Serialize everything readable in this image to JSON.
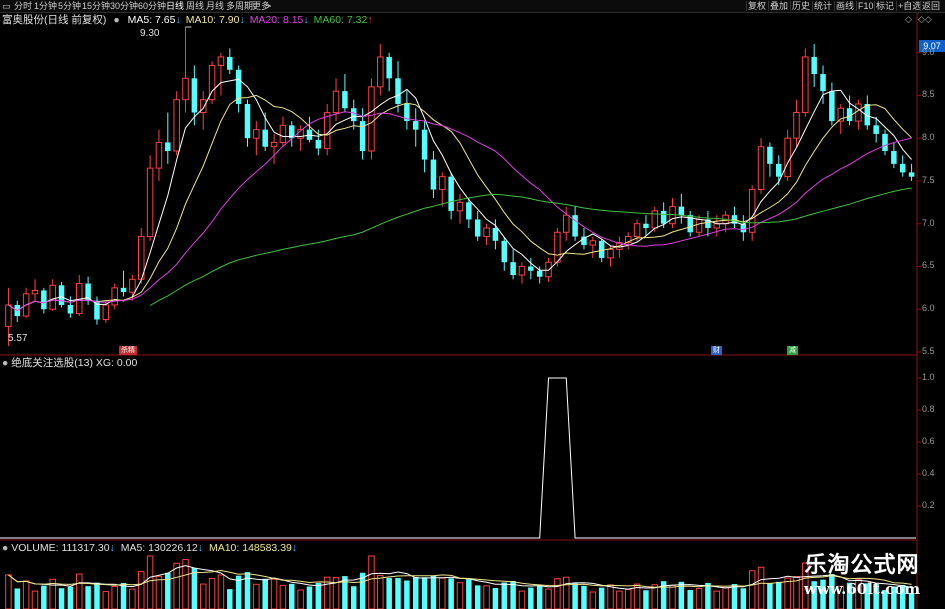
{
  "toolbar": {
    "left_icon": "window-icon",
    "items": [
      "分时",
      "1分钟",
      "5分钟",
      "15分钟",
      "30分钟",
      "60分钟",
      "日线",
      "周线",
      "月线",
      "多周期",
      "更多"
    ],
    "more_arrow": ">",
    "active_index": 6,
    "right_items": [
      "复权",
      "叠加",
      "历史",
      "统计",
      "画线",
      "F10",
      "标记",
      "+自选",
      "返回"
    ]
  },
  "main_panel": {
    "title": "富奥股份(日线 前复权)",
    "ma_items": [
      {
        "label": "MA5:",
        "value": "7.65",
        "arrow": "↓",
        "color": "#ffffff"
      },
      {
        "label": "MA10:",
        "value": "7.90",
        "arrow": "↓",
        "color": "#f0e68c"
      },
      {
        "label": "MA20:",
        "value": "8.15",
        "arrow": "↓",
        "color": "#e040e0"
      },
      {
        "label": "MA60:",
        "value": "7.32",
        "arrow": "↑",
        "color": "#40c040"
      }
    ],
    "high_label": "9.30",
    "low_label": "5.57",
    "current_price_tag": "9.07",
    "y_ticks": [
      "9.0",
      "8.5",
      "8.0",
      "7.5",
      "7.0",
      "6.5",
      "6.0",
      "5.5"
    ],
    "event_tags": [
      {
        "text": "杀精",
        "color": "#c03030"
      },
      {
        "text": "财",
        "color": "#3060c0"
      },
      {
        "text": "减",
        "color": "#30a040"
      }
    ],
    "icons": [
      "diamond-icon",
      "arrows-icon"
    ]
  },
  "indicator_panel": {
    "title": "绝底关注选股(13) XG: 0.00",
    "y_ticks": [
      "1.0",
      "0.8",
      "0.6",
      "0.4",
      "0.2"
    ]
  },
  "volume_panel": {
    "label": "VOLUME:",
    "value": "111317.30",
    "arrow": "↓",
    "ma5_label": "MA5:",
    "ma5_value": "130226.12",
    "ma5_arrow": "↓",
    "ma10_label": "MA10:",
    "ma10_value": "148583.39",
    "ma10_arrow": "↓"
  },
  "watermark": {
    "title": "乐淘公式网",
    "url": "www.60lt.com"
  },
  "colors": {
    "up": "#ff4040",
    "down": "#54ffff",
    "ma5": "#ffffff",
    "ma10": "#f0e68c",
    "ma20": "#e040e0",
    "ma60": "#40c040"
  },
  "chart_data": {
    "type": "candlestick",
    "ylim": [
      5.5,
      9.3
    ],
    "candles": [
      [
        5.8,
        6.25,
        5.57,
        6.05
      ],
      [
        6.05,
        6.1,
        5.85,
        5.92
      ],
      [
        5.92,
        6.25,
        5.9,
        6.18
      ],
      [
        6.18,
        6.35,
        6.1,
        6.22
      ],
      [
        6.22,
        6.25,
        5.95,
        6.0
      ],
      [
        6.0,
        6.35,
        5.98,
        6.28
      ],
      [
        6.28,
        6.32,
        6.02,
        6.05
      ],
      [
        6.05,
        6.15,
        5.9,
        5.95
      ],
      [
        5.95,
        6.4,
        5.92,
        6.3
      ],
      [
        6.3,
        6.38,
        6.05,
        6.1
      ],
      [
        6.1,
        6.15,
        5.82,
        5.88
      ],
      [
        5.88,
        6.1,
        5.84,
        6.05
      ],
      [
        6.05,
        6.3,
        6.0,
        6.25
      ],
      [
        6.25,
        6.45,
        6.15,
        6.2
      ],
      [
        6.2,
        6.4,
        6.1,
        6.35
      ],
      [
        6.35,
        6.95,
        6.3,
        6.85
      ],
      [
        6.85,
        7.8,
        6.8,
        7.65
      ],
      [
        7.65,
        8.1,
        7.5,
        7.95
      ],
      [
        7.95,
        8.3,
        7.7,
        7.85
      ],
      [
        7.85,
        8.55,
        7.8,
        8.45
      ],
      [
        8.45,
        9.3,
        8.3,
        8.7
      ],
      [
        8.7,
        8.85,
        8.15,
        8.3
      ],
      [
        8.3,
        8.55,
        8.1,
        8.45
      ],
      [
        8.45,
        8.9,
        8.4,
        8.85
      ],
      [
        8.85,
        9.0,
        8.5,
        8.95
      ],
      [
        8.95,
        9.05,
        8.75,
        8.8
      ],
      [
        8.8,
        8.85,
        8.3,
        8.4
      ],
      [
        8.4,
        8.45,
        7.9,
        8.0
      ],
      [
        8.0,
        8.2,
        7.8,
        8.1
      ],
      [
        8.1,
        8.3,
        7.85,
        7.9
      ],
      [
        7.9,
        8.05,
        7.7,
        7.95
      ],
      [
        7.95,
        8.25,
        7.9,
        8.15
      ],
      [
        8.15,
        8.2,
        7.9,
        8.0
      ],
      [
        8.0,
        8.15,
        7.85,
        8.1
      ],
      [
        8.1,
        8.25,
        7.95,
        7.98
      ],
      [
        7.98,
        8.1,
        7.8,
        7.88
      ],
      [
        7.88,
        8.4,
        7.8,
        8.3
      ],
      [
        8.3,
        8.7,
        8.2,
        8.55
      ],
      [
        8.55,
        8.75,
        8.3,
        8.35
      ],
      [
        8.35,
        8.45,
        8.1,
        8.2
      ],
      [
        8.2,
        8.35,
        7.75,
        7.85
      ],
      [
        7.85,
        8.7,
        7.75,
        8.6
      ],
      [
        8.6,
        9.1,
        8.5,
        8.95
      ],
      [
        8.95,
        9.0,
        8.55,
        8.7
      ],
      [
        8.7,
        8.9,
        8.3,
        8.4
      ],
      [
        8.4,
        8.55,
        8.1,
        8.2
      ],
      [
        8.2,
        8.35,
        7.9,
        8.1
      ],
      [
        8.1,
        8.2,
        7.6,
        7.75
      ],
      [
        7.75,
        7.85,
        7.3,
        7.4
      ],
      [
        7.4,
        7.6,
        7.2,
        7.55
      ],
      [
        7.55,
        7.6,
        7.05,
        7.15
      ],
      [
        7.15,
        7.35,
        7.0,
        7.25
      ],
      [
        7.25,
        7.3,
        6.95,
        7.05
      ],
      [
        7.05,
        7.15,
        6.8,
        6.85
      ],
      [
        6.85,
        7.0,
        6.75,
        6.95
      ],
      [
        6.95,
        7.05,
        6.7,
        6.8
      ],
      [
        6.8,
        6.85,
        6.45,
        6.55
      ],
      [
        6.55,
        6.7,
        6.35,
        6.4
      ],
      [
        6.4,
        6.55,
        6.3,
        6.5
      ],
      [
        6.5,
        6.6,
        6.35,
        6.45
      ],
      [
        6.45,
        6.5,
        6.3,
        6.38
      ],
      [
        6.38,
        6.6,
        6.32,
        6.55
      ],
      [
        6.55,
        6.95,
        6.5,
        6.9
      ],
      [
        6.9,
        7.2,
        6.8,
        7.1
      ],
      [
        7.1,
        7.2,
        6.8,
        6.85
      ],
      [
        6.85,
        6.95,
        6.7,
        6.75
      ],
      [
        6.75,
        6.85,
        6.6,
        6.8
      ],
      [
        6.8,
        6.82,
        6.55,
        6.6
      ],
      [
        6.6,
        6.75,
        6.5,
        6.7
      ],
      [
        6.7,
        6.85,
        6.6,
        6.78
      ],
      [
        6.78,
        6.9,
        6.7,
        6.85
      ],
      [
        6.85,
        7.05,
        6.8,
        7.0
      ],
      [
        7.0,
        7.1,
        6.85,
        6.95
      ],
      [
        6.95,
        7.2,
        6.9,
        7.15
      ],
      [
        7.15,
        7.25,
        6.95,
        7.0
      ],
      [
        7.0,
        7.3,
        6.95,
        7.2
      ],
      [
        7.2,
        7.35,
        7.0,
        7.1
      ],
      [
        7.1,
        7.15,
        6.85,
        6.9
      ],
      [
        6.9,
        7.1,
        6.85,
        7.05
      ],
      [
        7.05,
        7.15,
        6.85,
        6.95
      ],
      [
        6.95,
        7.1,
        6.85,
        7.0
      ],
      [
        7.0,
        7.15,
        6.9,
        7.1
      ],
      [
        7.1,
        7.2,
        6.95,
        7.0
      ],
      [
        7.0,
        7.1,
        6.8,
        6.9
      ],
      [
        6.9,
        7.45,
        6.8,
        7.4
      ],
      [
        7.4,
        8.0,
        7.35,
        7.9
      ],
      [
        7.9,
        7.95,
        7.55,
        7.7
      ],
      [
        7.7,
        7.8,
        7.45,
        7.55
      ],
      [
        7.55,
        8.1,
        7.5,
        8.0
      ],
      [
        8.0,
        8.45,
        7.9,
        8.3
      ],
      [
        8.3,
        9.05,
        8.25,
        8.95
      ],
      [
        8.95,
        9.1,
        8.6,
        8.75
      ],
      [
        8.75,
        8.85,
        8.4,
        8.55
      ],
      [
        8.55,
        8.65,
        8.15,
        8.2
      ],
      [
        8.2,
        8.4,
        8.05,
        8.35
      ],
      [
        8.35,
        8.5,
        8.15,
        8.2
      ],
      [
        8.2,
        8.45,
        8.1,
        8.4
      ],
      [
        8.4,
        8.5,
        8.1,
        8.15
      ],
      [
        8.15,
        8.25,
        7.95,
        8.05
      ],
      [
        8.05,
        8.1,
        7.8,
        7.85
      ],
      [
        7.85,
        7.95,
        7.65,
        7.7
      ],
      [
        7.7,
        7.8,
        7.55,
        7.6
      ],
      [
        7.6,
        7.7,
        7.5,
        7.55
      ]
    ],
    "indicator": {
      "ylim": [
        0,
        1.05
      ],
      "pulse": {
        "rise_start": 60,
        "top_start": 61,
        "top_end": 63,
        "fall_end": 64
      }
    },
    "volume_ylim": [
      0,
      60
    ]
  }
}
